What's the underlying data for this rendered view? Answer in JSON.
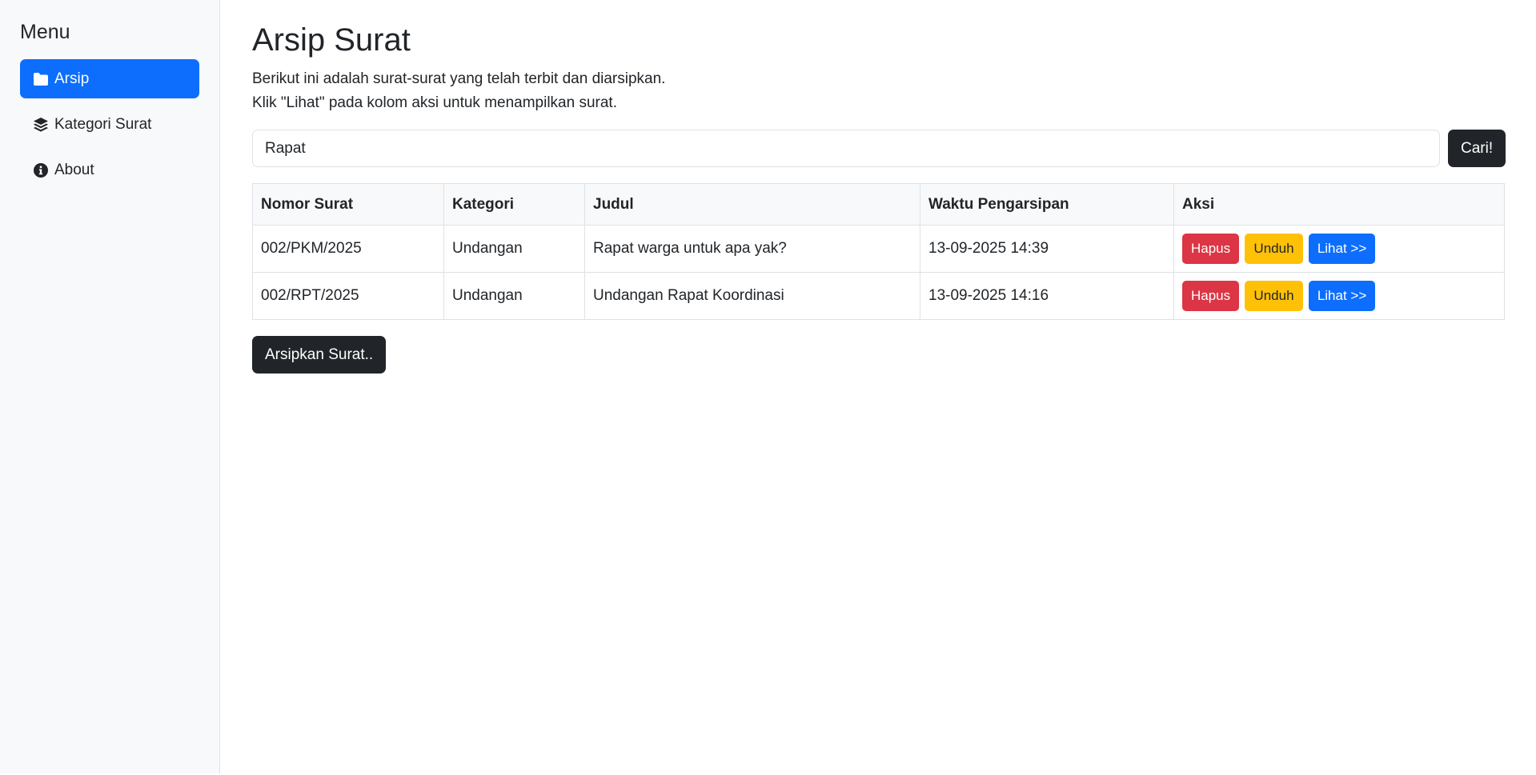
{
  "sidebar": {
    "title": "Menu",
    "items": [
      {
        "label": "Arsip",
        "icon": "folder-icon",
        "active": true
      },
      {
        "label": "Kategori Surat",
        "icon": "layers-icon",
        "active": false
      },
      {
        "label": "About",
        "icon": "info-circle-icon",
        "active": false
      }
    ]
  },
  "main": {
    "title": "Arsip Surat",
    "description_line1": "Berikut ini adalah surat-surat yang telah terbit dan diarsipkan.",
    "description_line2": "Klik \"Lihat\" pada kolom aksi untuk menampilkan surat.",
    "search": {
      "value": "Rapat",
      "button_label": "Cari!"
    },
    "table": {
      "headers": [
        "Nomor Surat",
        "Kategori",
        "Judul",
        "Waktu Pengarsipan",
        "Aksi"
      ],
      "rows": [
        {
          "nomor": "002/PKM/2025",
          "kategori": "Undangan",
          "judul": "Rapat warga untuk apa yak?",
          "waktu": "13-09-2025 14:39"
        },
        {
          "nomor": "002/RPT/2025",
          "kategori": "Undangan",
          "judul": "Undangan Rapat Koordinasi",
          "waktu": "13-09-2025 14:16"
        }
      ],
      "actions": {
        "delete_label": "Hapus",
        "download_label": "Unduh",
        "view_label": "Lihat >>"
      }
    },
    "archive_button_label": "Arsipkan Surat.."
  },
  "colors": {
    "primary": "#0d6efd",
    "danger": "#dc3545",
    "warning": "#ffc107",
    "dark": "#212529",
    "sidebar_bg": "#f8f9fa"
  }
}
